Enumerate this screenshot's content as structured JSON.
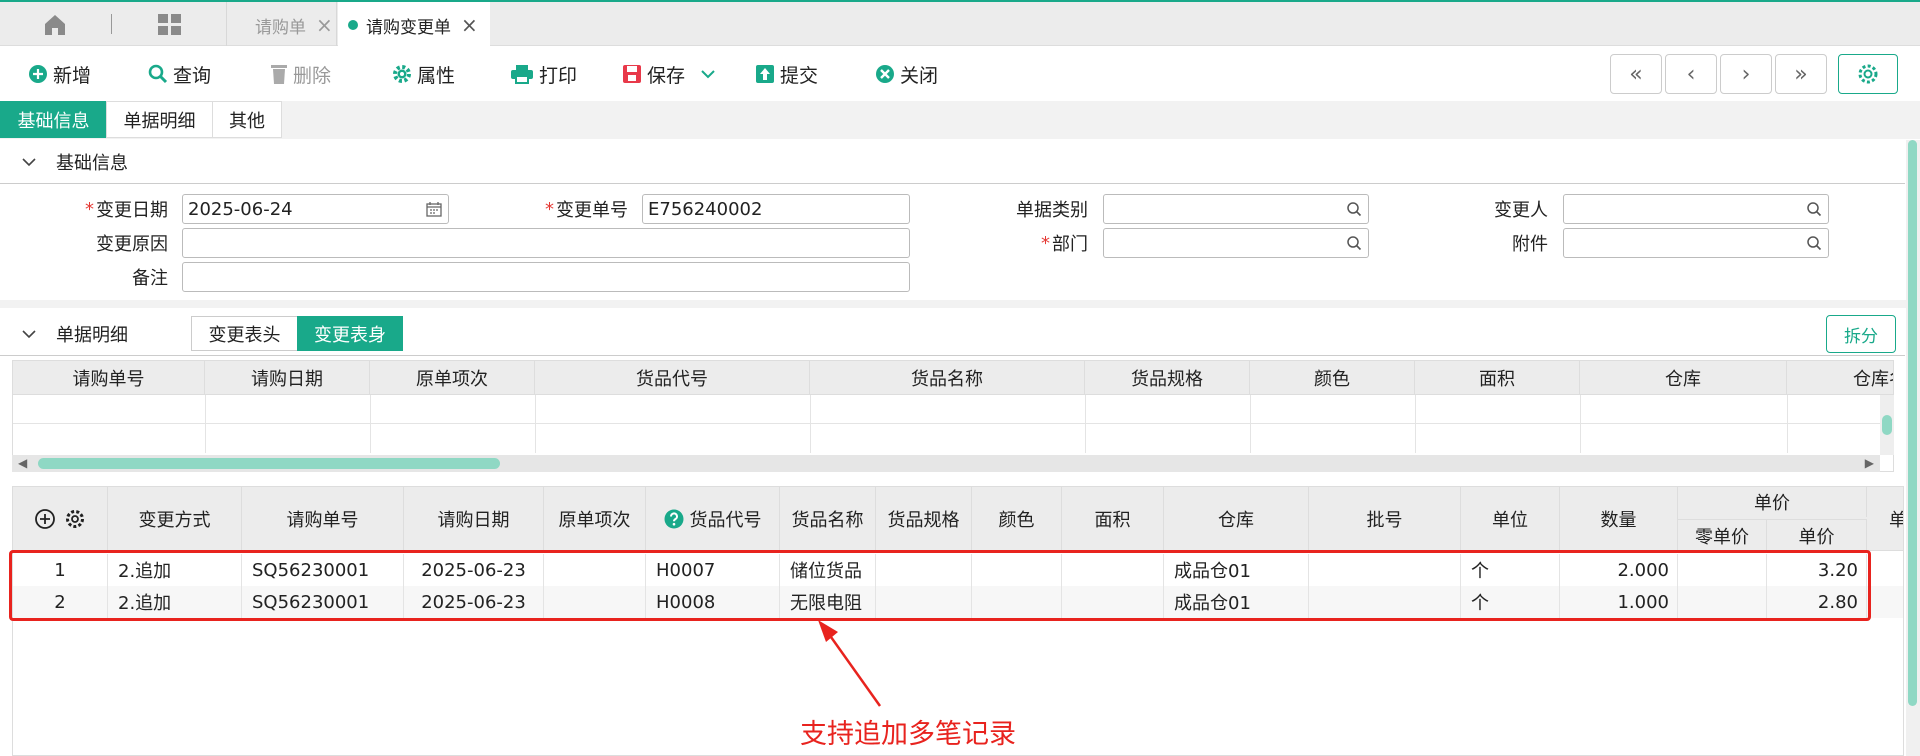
{
  "tabs": [
    {
      "label": "请购单",
      "close": "×"
    },
    {
      "label": "请购变更单",
      "close": "×"
    }
  ],
  "toolbar": {
    "add": "新增",
    "query": "查询",
    "delete": "删除",
    "props": "属性",
    "print": "打印",
    "save": "保存",
    "submit": "提交",
    "close": "关闭",
    "nav_first": "«",
    "nav_prev": "‹",
    "nav_next": "›",
    "nav_last": "»"
  },
  "section_tabs": [
    "基础信息",
    "单据明细",
    "其他"
  ],
  "basic": {
    "title": "基础信息",
    "change_date_label": "变更日期",
    "change_date_value": "2025-06-24",
    "change_no_label": "变更单号",
    "change_no_value": "E756240002",
    "doc_type_label": "单据类别",
    "doc_type_value": "",
    "changer_label": "变更人",
    "changer_value": "",
    "reason_label": "变更原因",
    "reason_value": "",
    "dept_label": "部门",
    "dept_value": "",
    "attach_label": "附件",
    "attach_value": "",
    "remark_label": "备注",
    "remark_value": "",
    "required_mark": "*"
  },
  "detail": {
    "title": "单据明细",
    "sub_tabs": [
      "变更表头",
      "变更表身"
    ],
    "split_button": "拆分",
    "upper_headers": [
      "请购单号",
      "请购日期",
      "原单项次",
      "货品代号",
      "货品名称",
      "货品规格",
      "颜色",
      "面积",
      "仓库",
      "仓库名"
    ],
    "lower_headers": {
      "method": "变更方式",
      "req_no": "请购单号",
      "req_date": "请购日期",
      "orig_item": "原单项次",
      "item_code": "货品代号",
      "item_name": "货品名称",
      "item_spec": "货品规格",
      "color": "颜色",
      "area": "面积",
      "warehouse": "仓库",
      "batch": "批号",
      "unit": "单位",
      "qty": "数量",
      "price_group": "单价",
      "retail_price": "零单价",
      "price": "单价",
      "extra": "单"
    },
    "rows": [
      {
        "seq": "1",
        "method": "2.追加",
        "req_no": "SQ56230001",
        "req_date": "2025-06-23",
        "orig_item": "",
        "item_code": "H0007",
        "item_name": "储位货品",
        "item_spec": "",
        "color": "",
        "area": "",
        "warehouse": "成品仓01",
        "batch": "",
        "unit": "个",
        "qty": "2.000",
        "retail_price": "",
        "price": "3.20"
      },
      {
        "seq": "2",
        "method": "2.追加",
        "req_no": "SQ56230001",
        "req_date": "2025-06-23",
        "orig_item": "",
        "item_code": "H0008",
        "item_name": "无限电阻",
        "item_spec": "",
        "color": "",
        "area": "",
        "warehouse": "成品仓01",
        "batch": "",
        "unit": "个",
        "qty": "1.000",
        "retail_price": "",
        "price": "2.80"
      }
    ]
  },
  "annotation": "支持追加多笔记录",
  "colors": {
    "accent": "#19a98a",
    "annotation": "#e8231e"
  }
}
